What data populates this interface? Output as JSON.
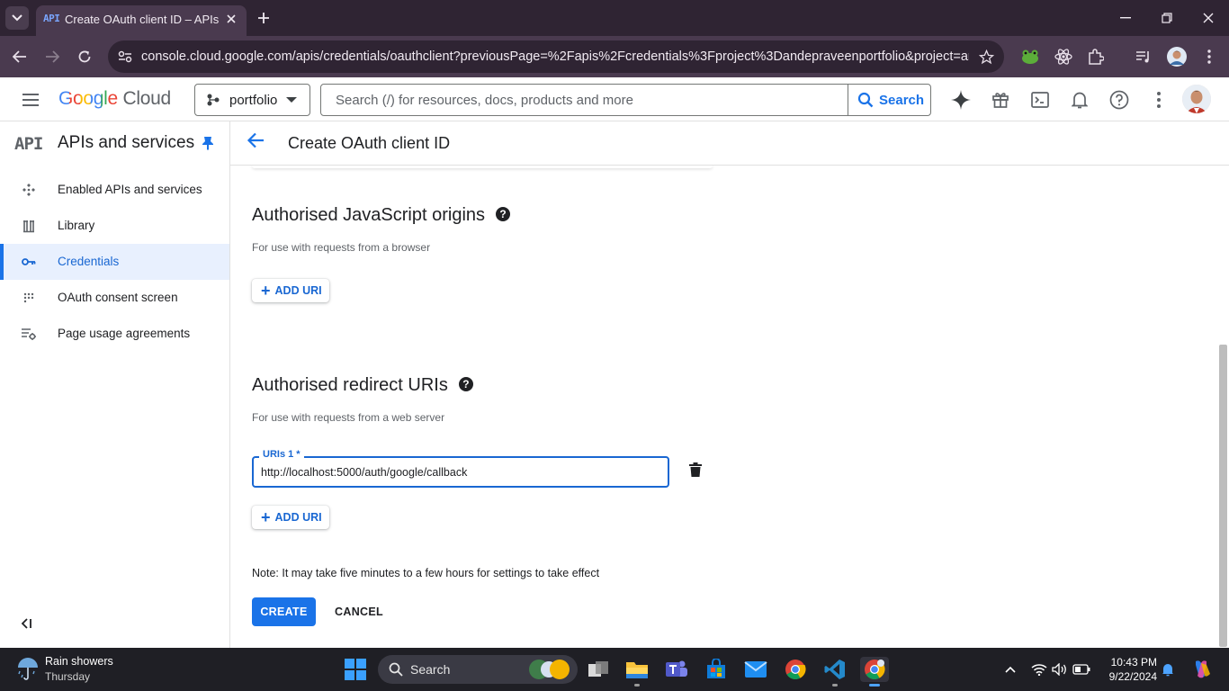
{
  "browser": {
    "tab_title": "Create OAuth client ID – APIs and services",
    "tab_favicon": "API",
    "url": "console.cloud.google.com/apis/credentials/oauthclient?previousPage=%2Fapis%2Fcredentials%3Fproject%3Dandepraveenportfolio&project=ande..."
  },
  "header": {
    "logo_google": "Google",
    "logo_cloud": "Cloud",
    "project_name": "portfolio",
    "search_placeholder": "Search (/) for resources, docs, products and more",
    "search_button": "Search"
  },
  "sidebar": {
    "logo": "API",
    "title": "APIs and services",
    "items": [
      {
        "label": "Enabled APIs and services",
        "icon": "apis-icon",
        "active": false
      },
      {
        "label": "Library",
        "icon": "library-icon",
        "active": false
      },
      {
        "label": "Credentials",
        "icon": "key-icon",
        "active": true
      },
      {
        "label": "OAuth consent screen",
        "icon": "consent-icon",
        "active": false
      },
      {
        "label": "Page usage agreements",
        "icon": "settings-list-icon",
        "active": false
      }
    ]
  },
  "page": {
    "title": "Create OAuth client ID",
    "js_origins": {
      "title": "Authorised JavaScript origins",
      "subtitle": "For use with requests from a browser",
      "add_label": "ADD URI"
    },
    "redirect_uris": {
      "title": "Authorised redirect URIs",
      "subtitle": "For use with requests from a web server",
      "field_label": "URIs 1 *",
      "field_value": "http://localhost:5000/auth/google/callback",
      "add_label": "ADD URI"
    },
    "note": "Note: It may take five minutes to a few hours for settings to take effect",
    "create_label": "CREATE",
    "cancel_label": "CANCEL"
  },
  "taskbar": {
    "weather_text": "Rain showers",
    "weather_day": "Thursday",
    "search_label": "Search",
    "time": "10:43 PM",
    "date": "9/22/2024"
  },
  "colors": {
    "accent": "#1a73e8",
    "active_bg": "#e8f0fe",
    "browser_frame": "#2f2433",
    "taskbar": "#1f1f25"
  }
}
